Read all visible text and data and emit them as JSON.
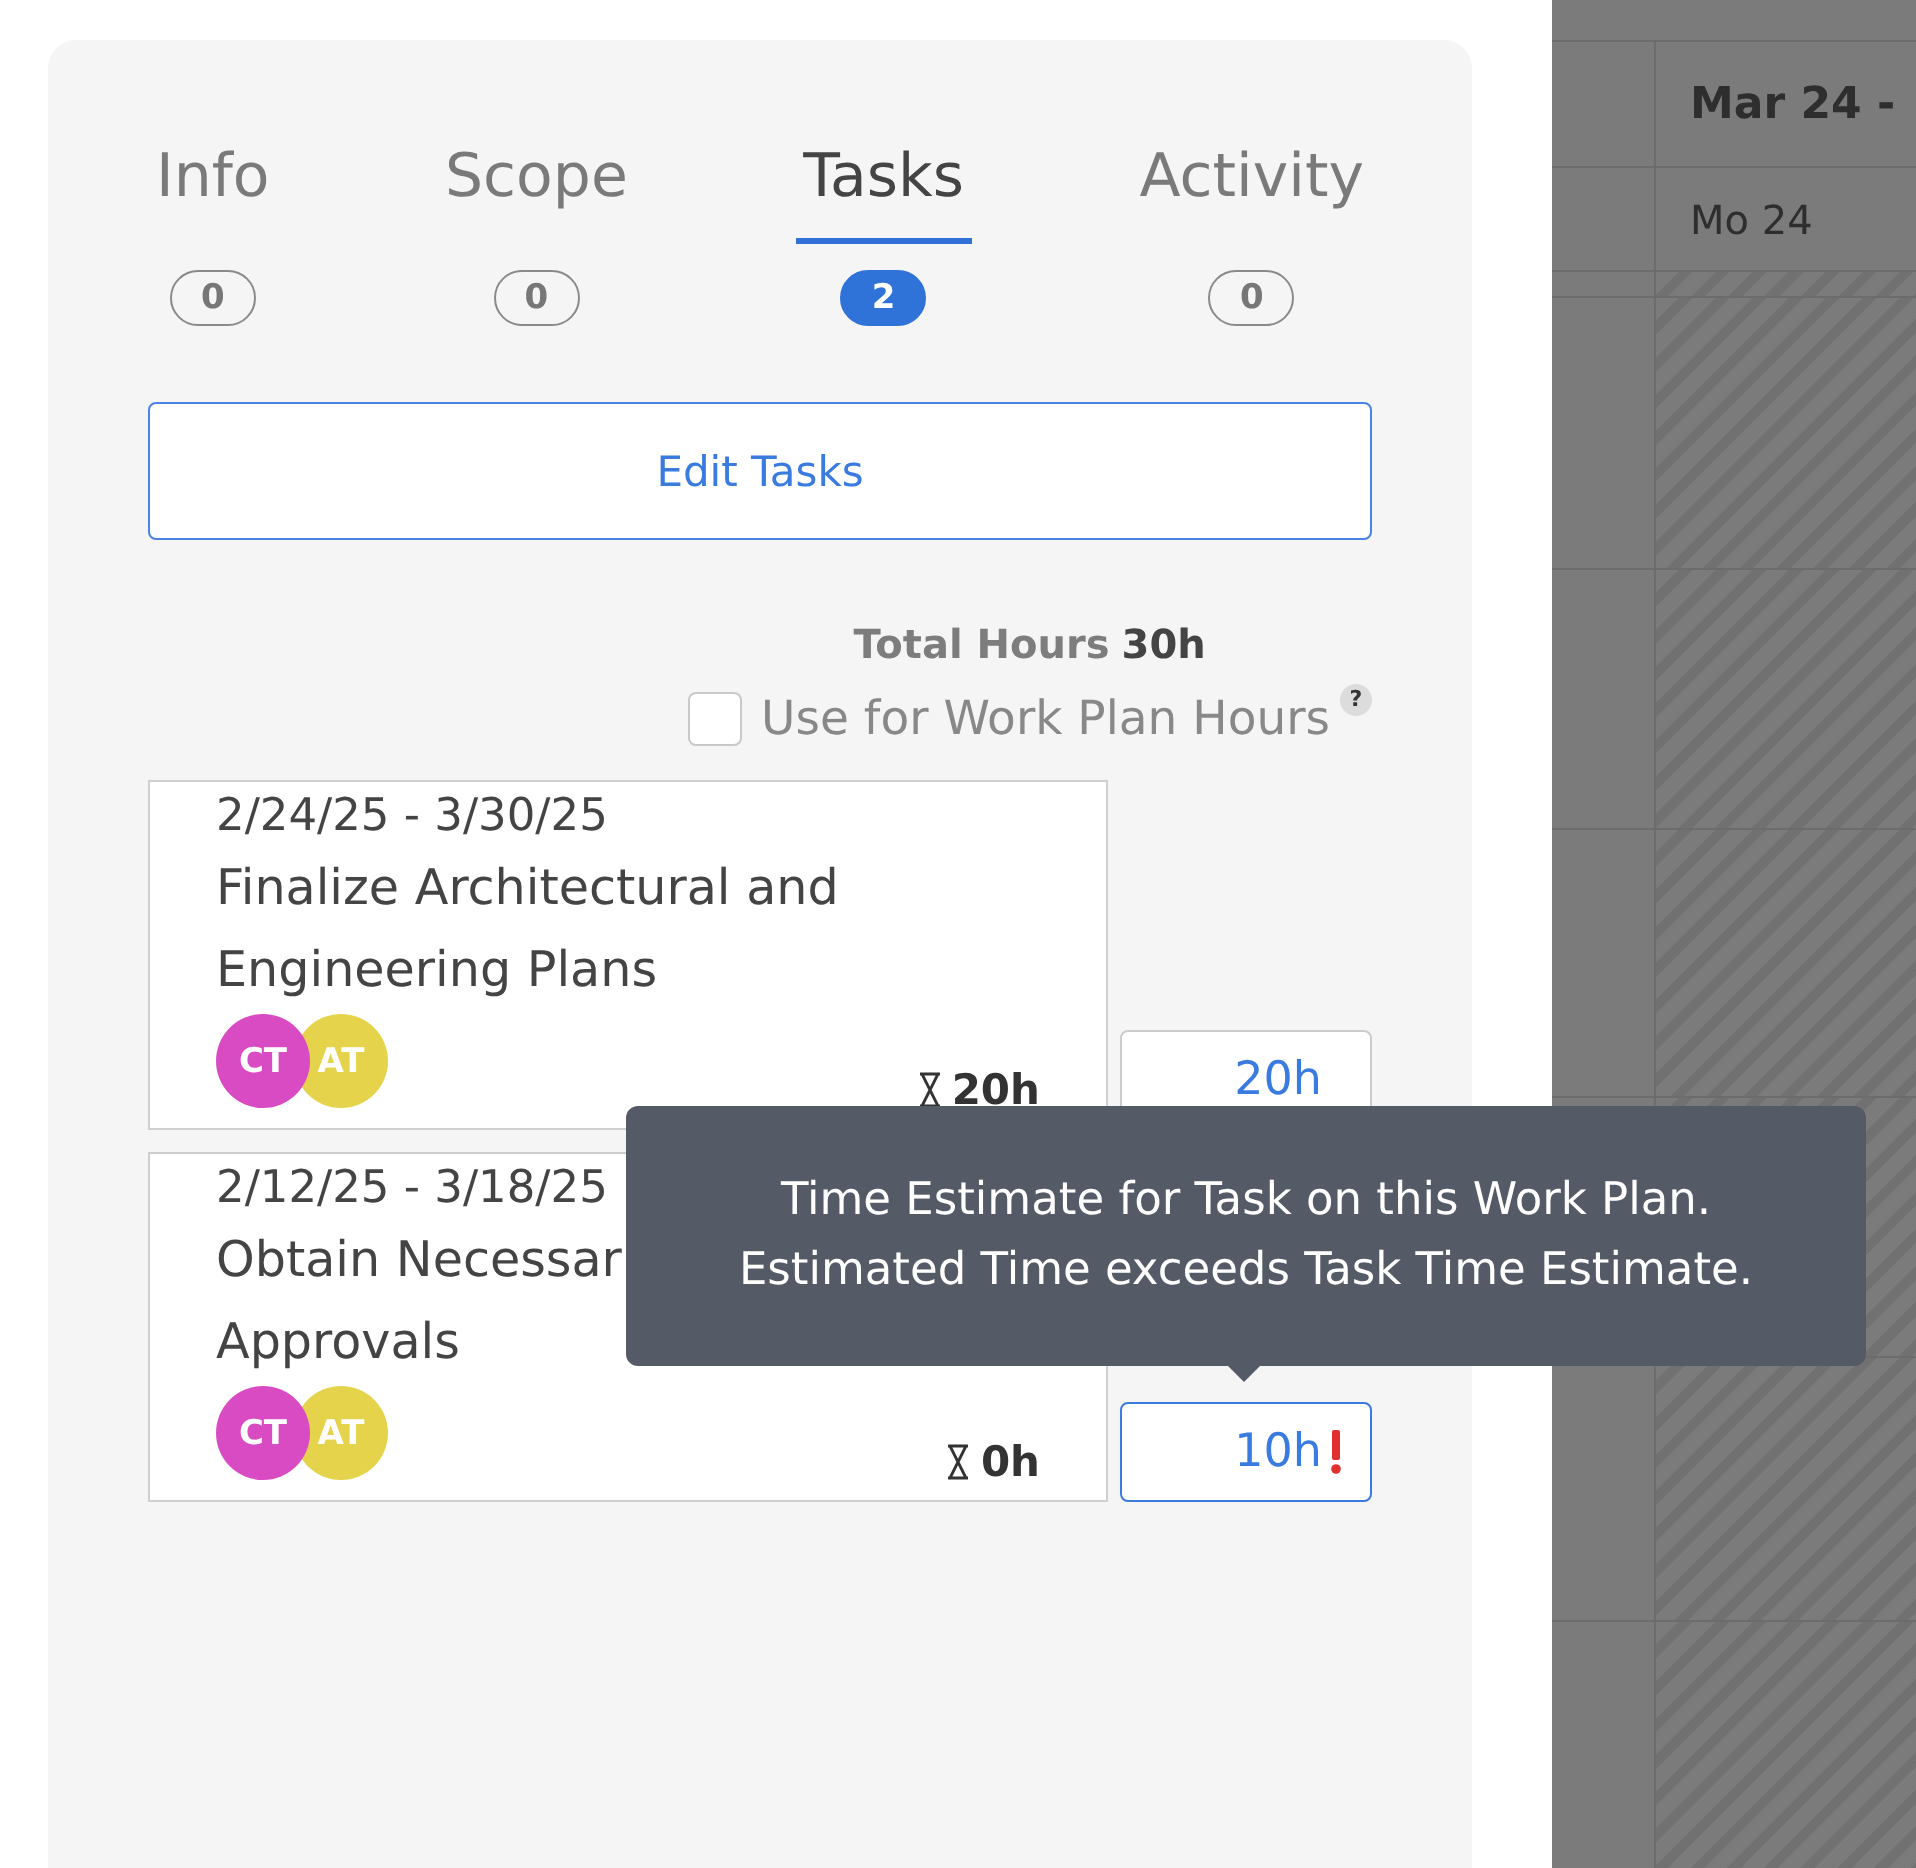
{
  "tabs": [
    {
      "label": "Info",
      "count": "0",
      "selected": false
    },
    {
      "label": "Scope",
      "count": "0",
      "selected": false
    },
    {
      "label": "Tasks",
      "count": "2",
      "selected": true
    },
    {
      "label": "Activity",
      "count": "0",
      "selected": false
    }
  ],
  "edit_button": {
    "label": "Edit Tasks"
  },
  "total_hours": {
    "label": "Total Hours",
    "value": "30h"
  },
  "work_plan_option": {
    "label": "Use for Work Plan Hours",
    "checked": false,
    "help": "?"
  },
  "tasks": [
    {
      "dates": "2/24/25 - 3/30/25",
      "title_lines": [
        "Finalize Architectural and",
        "Engineering Plans"
      ],
      "assignees": [
        {
          "initials": "CT",
          "color": "#d84bc3"
        },
        {
          "initials": "AT",
          "color": "#e5d44b"
        }
      ],
      "estimate": "20h",
      "hours": "20h",
      "focused": false,
      "warning": false
    },
    {
      "dates": "2/12/25 - 3/18/25",
      "title_lines": [
        "Obtain Necessar",
        "Approvals"
      ],
      "assignees": [
        {
          "initials": "CT",
          "color": "#d84bc3"
        },
        {
          "initials": "AT",
          "color": "#e5d44b"
        }
      ],
      "estimate": "0h",
      "hours": "10h",
      "focused": true,
      "warning": true
    }
  ],
  "tooltip": {
    "lines": [
      "Time Estimate for Task on this Work Plan.",
      "Estimated Time exceeds Task Time Estimate."
    ]
  },
  "calendar": {
    "week_range": "Mar 24 -",
    "day": "Mo 24"
  }
}
